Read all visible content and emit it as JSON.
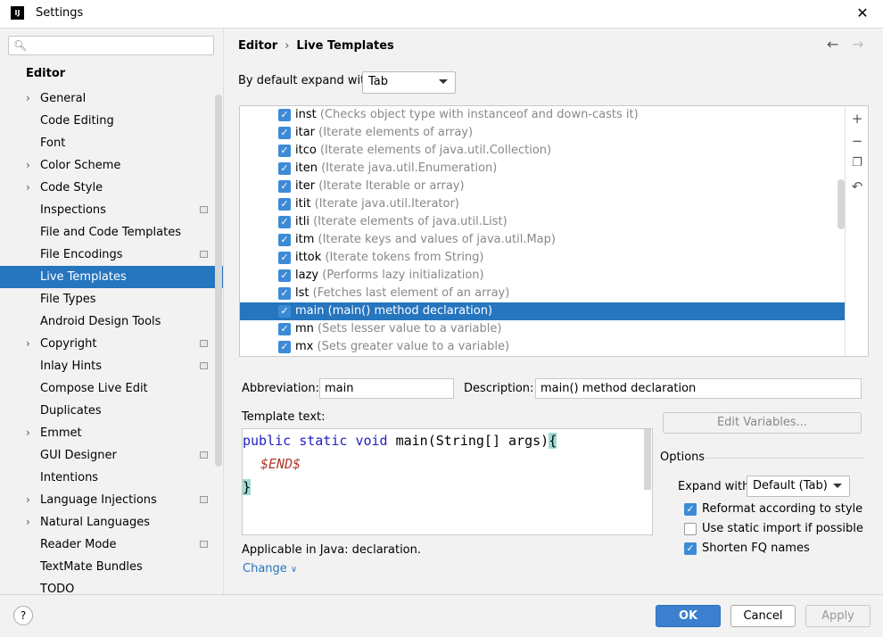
{
  "window": {
    "title": "Settings",
    "app_icon": "IJ",
    "close_glyph": "✕"
  },
  "sidebar": {
    "search_placeholder": "",
    "section_title": "Editor",
    "items": [
      {
        "label": "General",
        "expandable": true,
        "project": false
      },
      {
        "label": "Code Editing",
        "expandable": false,
        "project": false
      },
      {
        "label": "Font",
        "expandable": false,
        "project": false
      },
      {
        "label": "Color Scheme",
        "expandable": true,
        "project": false
      },
      {
        "label": "Code Style",
        "expandable": true,
        "project": false
      },
      {
        "label": "Inspections",
        "expandable": false,
        "project": true
      },
      {
        "label": "File and Code Templates",
        "expandable": false,
        "project": false
      },
      {
        "label": "File Encodings",
        "expandable": false,
        "project": true
      },
      {
        "label": "Live Templates",
        "expandable": false,
        "project": false,
        "selected": true
      },
      {
        "label": "File Types",
        "expandable": false,
        "project": false
      },
      {
        "label": "Android Design Tools",
        "expandable": false,
        "project": false
      },
      {
        "label": "Copyright",
        "expandable": true,
        "project": true
      },
      {
        "label": "Inlay Hints",
        "expandable": false,
        "project": true
      },
      {
        "label": "Compose Live Edit",
        "expandable": false,
        "project": false
      },
      {
        "label": "Duplicates",
        "expandable": false,
        "project": false
      },
      {
        "label": "Emmet",
        "expandable": true,
        "project": false
      },
      {
        "label": "GUI Designer",
        "expandable": false,
        "project": true
      },
      {
        "label": "Intentions",
        "expandable": false,
        "project": false
      },
      {
        "label": "Language Injections",
        "expandable": true,
        "project": true
      },
      {
        "label": "Natural Languages",
        "expandable": true,
        "project": false
      },
      {
        "label": "Reader Mode",
        "expandable": false,
        "project": true
      },
      {
        "label": "TextMate Bundles",
        "expandable": false,
        "project": false
      },
      {
        "label": "TODO",
        "expandable": false,
        "project": false
      }
    ]
  },
  "main": {
    "breadcrumb": {
      "parent": "Editor",
      "sep": "›",
      "current": "Live Templates"
    },
    "expand_default_label": "By default expand with",
    "expand_default_value": "Tab",
    "templates": [
      {
        "abbr": "inst",
        "desc": "(Checks object type with instanceof and down-casts it)"
      },
      {
        "abbr": "itar",
        "desc": "(Iterate elements of array)"
      },
      {
        "abbr": "itco",
        "desc": "(Iterate elements of java.util.Collection)"
      },
      {
        "abbr": "iten",
        "desc": "(Iterate java.util.Enumeration)"
      },
      {
        "abbr": "iter",
        "desc": "(Iterate Iterable or array)"
      },
      {
        "abbr": "itit",
        "desc": "(Iterate java.util.Iterator)"
      },
      {
        "abbr": "itli",
        "desc": "(Iterate elements of java.util.List)"
      },
      {
        "abbr": "itm",
        "desc": "(Iterate keys and values of java.util.Map)"
      },
      {
        "abbr": "ittok",
        "desc": "(Iterate tokens from String)"
      },
      {
        "abbr": "lazy",
        "desc": "(Performs lazy initialization)"
      },
      {
        "abbr": "lst",
        "desc": "(Fetches last element of an array)"
      },
      {
        "abbr": "main",
        "desc": "(main() method declaration)",
        "selected": true
      },
      {
        "abbr": "mn",
        "desc": "(Sets lesser value to a variable)"
      },
      {
        "abbr": "mx",
        "desc": "(Sets greater value to a variable)"
      }
    ],
    "abbreviation_label": "Abbreviation:",
    "abbreviation_value": "main",
    "description_label": "Description:",
    "description_value": "main() method declaration",
    "template_text_label": "Template text:",
    "code": {
      "kw1": "public",
      "kw2": "static",
      "kw3": "void",
      "sig": "main(String[] args)",
      "open_brace": "{",
      "end_var": "$END$",
      "close_brace": "}"
    },
    "edit_variables_label": "Edit Variables...",
    "options_title": "Options",
    "expand_with_label": "Expand with",
    "expand_with_value": "Default (Tab)",
    "reformat_label": "Reformat according to style",
    "static_import_label": "Use static import if possible",
    "shorten_fq_label": "Shorten FQ names",
    "applicable_text": "Applicable in Java: declaration.",
    "change_label": "Change"
  },
  "footer": {
    "help": "?",
    "ok": "OK",
    "cancel": "Cancel",
    "apply": "Apply"
  }
}
